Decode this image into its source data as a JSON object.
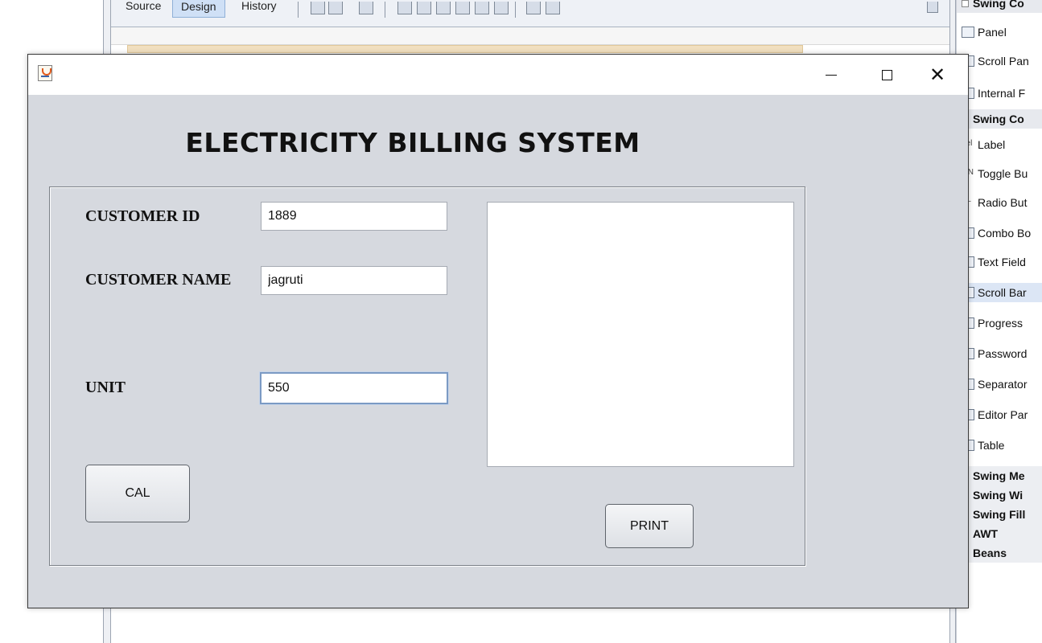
{
  "ide": {
    "tabs": [
      "Source",
      "Design",
      "History"
    ],
    "active_tab": "Design",
    "palette": [
      {
        "label": "Swing Co",
        "type": "header"
      },
      {
        "label": "Panel",
        "type": "item"
      },
      {
        "label": "Scroll Pan",
        "type": "item"
      },
      {
        "label": "Internal F",
        "type": "item"
      },
      {
        "label": "Swing Co",
        "type": "header"
      },
      {
        "label": "Label",
        "type": "item",
        "prefix": "bel"
      },
      {
        "label": "Toggle Bu",
        "type": "item",
        "prefix": "ON"
      },
      {
        "label": "Radio But",
        "type": "item",
        "prefix": "○–"
      },
      {
        "label": "Combo Bo",
        "type": "item"
      },
      {
        "label": "Text Field",
        "type": "item"
      },
      {
        "label": "Scroll Bar",
        "type": "selected"
      },
      {
        "label": "Progress",
        "type": "item"
      },
      {
        "label": "Password",
        "type": "item"
      },
      {
        "label": "Separator",
        "type": "item"
      },
      {
        "label": "Editor Par",
        "type": "item"
      },
      {
        "label": "Table",
        "type": "item"
      },
      {
        "label": "Swing Me",
        "type": "group"
      },
      {
        "label": "Swing Wi",
        "type": "group"
      },
      {
        "label": "Swing Fill",
        "type": "group"
      },
      {
        "label": "AWT",
        "type": "group"
      },
      {
        "label": "Beans",
        "type": "group"
      }
    ]
  },
  "window": {
    "controls": {
      "minimize": "—",
      "maximize": "□",
      "close": "✕"
    }
  },
  "app": {
    "title": "ELECTRICITY BILLING SYSTEM",
    "customer_id": {
      "label": "CUSTOMER ID",
      "value": "1889"
    },
    "customer_name": {
      "label": "CUSTOMER NAME",
      "value": "jagruti"
    },
    "unit": {
      "label": "UNIT",
      "value": "550"
    },
    "output_text": "",
    "cal_label": "CAL",
    "print_label": "PRINT"
  }
}
